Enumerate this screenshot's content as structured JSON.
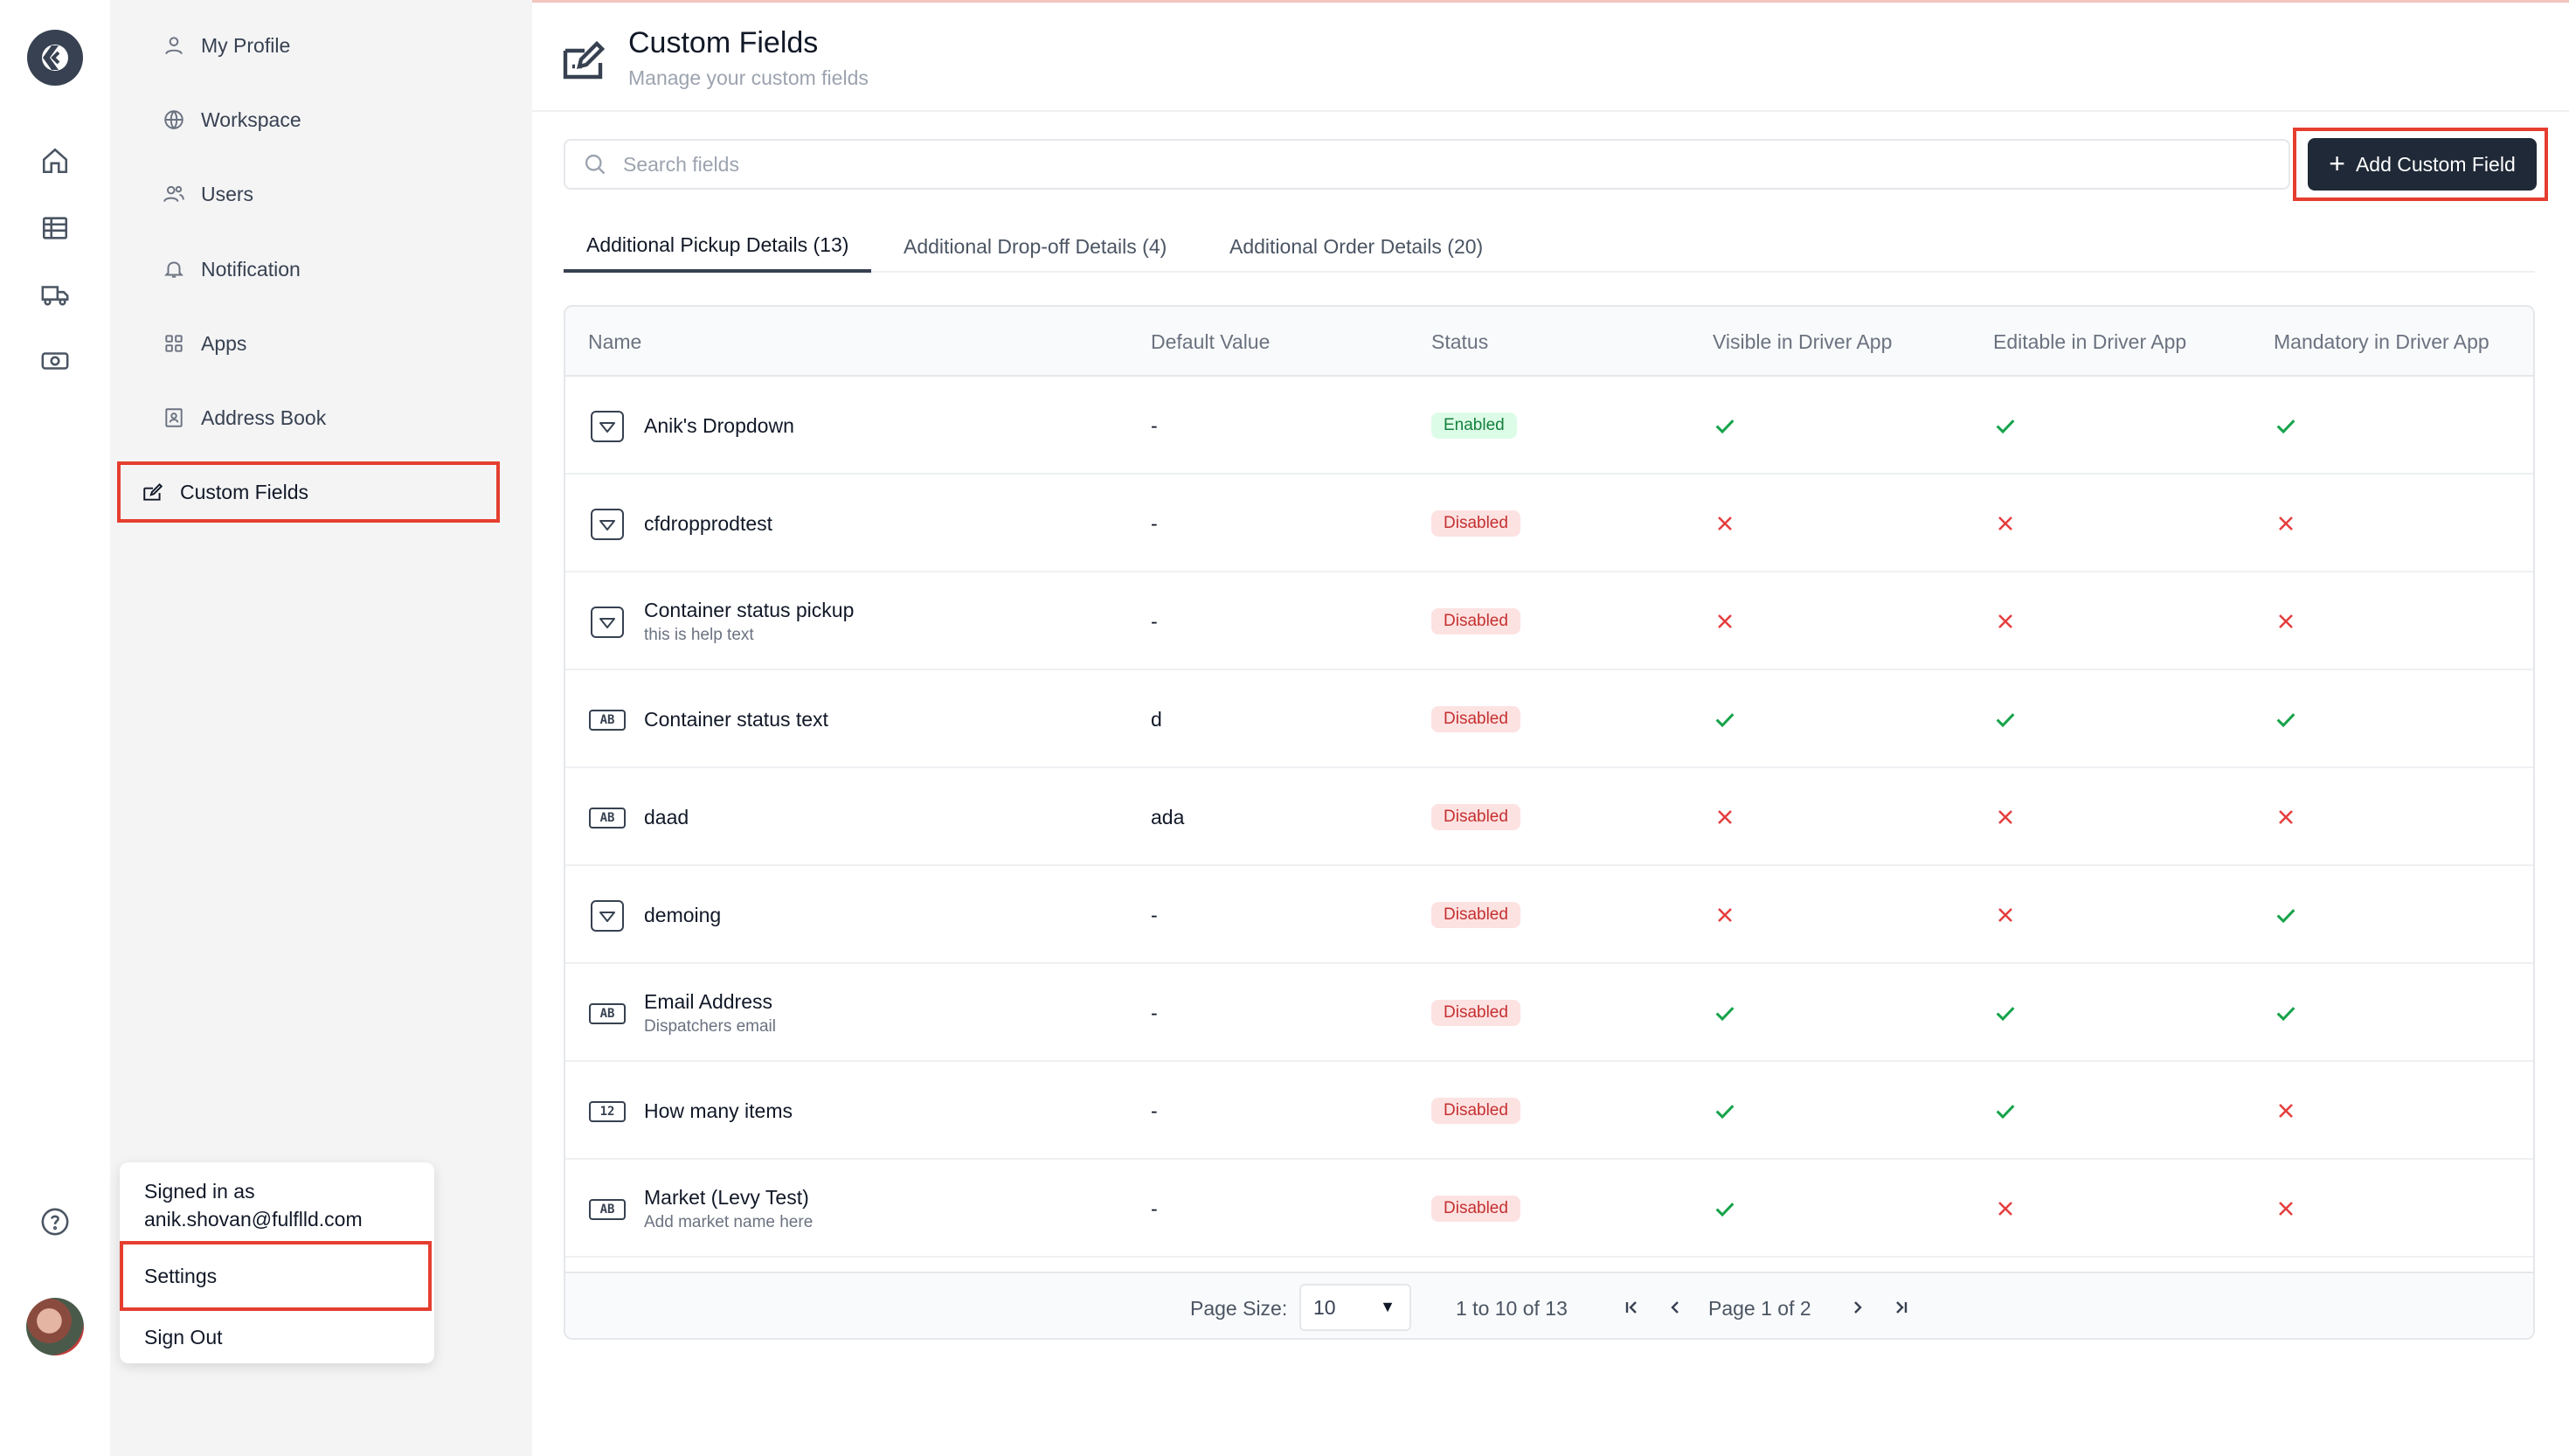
{
  "header": {
    "title": "Custom Fields",
    "subtitle": "Manage your custom fields"
  },
  "rail": {
    "icons": [
      "logo-icon",
      "home-icon",
      "table-icon",
      "truck-icon",
      "cash-icon",
      "help-icon"
    ]
  },
  "subnav": {
    "items": [
      {
        "label": "My Profile",
        "icon": "user-icon"
      },
      {
        "label": "Workspace",
        "icon": "globe-icon"
      },
      {
        "label": "Users",
        "icon": "users-icon"
      },
      {
        "label": "Notification",
        "icon": "bell-icon"
      },
      {
        "label": "Apps",
        "icon": "apps-icon"
      },
      {
        "label": "Address Book",
        "icon": "contact-book-icon"
      },
      {
        "label": "Custom Fields",
        "icon": "edit-field-icon",
        "active": true
      }
    ]
  },
  "account": {
    "signed_in_label": "Signed in as",
    "email": "anik.shovan@fulflld.com",
    "settings_label": "Settings",
    "signout_label": "Sign Out"
  },
  "search": {
    "placeholder": "Search fields",
    "value": ""
  },
  "add_button": {
    "label": "Add Custom Field"
  },
  "tabs": [
    {
      "label": "Additional Pickup Details (13)",
      "active": true
    },
    {
      "label": "Additional Drop-off Details (4)",
      "active": false
    },
    {
      "label": "Additional Order Details (20)",
      "active": false
    }
  ],
  "table": {
    "columns": [
      "Name",
      "Default Value",
      "Status",
      "Visible in Driver App",
      "Editable in Driver App",
      "Mandatory in Driver App"
    ],
    "rows": [
      {
        "type": "dropdown",
        "name": "Anik's Dropdown",
        "help": "",
        "default": "-",
        "status": "Enabled",
        "visible": true,
        "editable": true,
        "mandatory": true
      },
      {
        "type": "dropdown",
        "name": "cfdropprodtest",
        "help": "",
        "default": "-",
        "status": "Disabled",
        "visible": false,
        "editable": false,
        "mandatory": false
      },
      {
        "type": "dropdown",
        "name": "Container status pickup",
        "help": "this is help text",
        "default": "-",
        "status": "Disabled",
        "visible": false,
        "editable": false,
        "mandatory": false
      },
      {
        "type": "text",
        "name": "Container status text",
        "help": "",
        "default": "d",
        "status": "Disabled",
        "visible": true,
        "editable": true,
        "mandatory": true
      },
      {
        "type": "text",
        "name": "daad",
        "help": "",
        "default": "ada",
        "status": "Disabled",
        "visible": false,
        "editable": false,
        "mandatory": false
      },
      {
        "type": "dropdown",
        "name": "demoing",
        "help": "",
        "default": "-",
        "status": "Disabled",
        "visible": false,
        "editable": false,
        "mandatory": true
      },
      {
        "type": "text",
        "name": "Email Address",
        "help": "Dispatchers email",
        "default": "-",
        "status": "Disabled",
        "visible": true,
        "editable": true,
        "mandatory": true
      },
      {
        "type": "number",
        "name": "How many items",
        "help": "",
        "default": "-",
        "status": "Disabled",
        "visible": true,
        "editable": true,
        "mandatory": false
      },
      {
        "type": "text",
        "name": "Market (Levy Test)",
        "help": "Add market name here",
        "default": "-",
        "status": "Disabled",
        "visible": true,
        "editable": false,
        "mandatory": false
      }
    ],
    "type_badges": {
      "text": "AB",
      "number": "12"
    }
  },
  "pagination": {
    "page_size_label": "Page Size:",
    "page_size": "10",
    "range": "1 to 10 of 13",
    "page_label": "Page 1 of 2"
  },
  "colors": {
    "accent_dark": "#1f2937",
    "highlight": "#e53e2f",
    "enabled": "#15803d",
    "disabled": "#c53030"
  }
}
